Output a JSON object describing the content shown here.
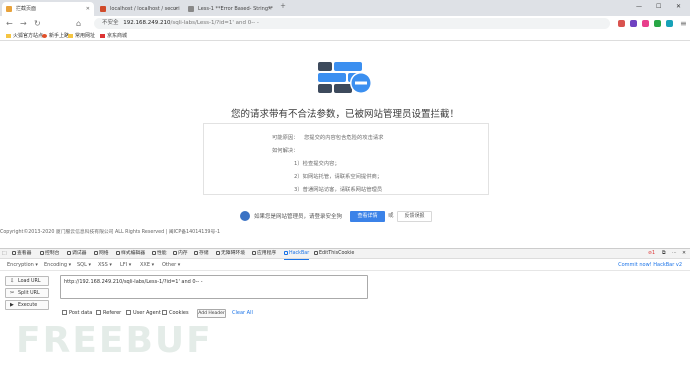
{
  "browser": {
    "tabs": [
      {
        "title": "拦截页面",
        "favicon_color": "#e8a23b"
      },
      {
        "title": "localhost / localhost / securi",
        "favicon_color": "#d04a2a"
      },
      {
        "title": "Less-1 **Error Based- String**",
        "favicon_color": "#888888"
      }
    ],
    "address": {
      "insecure_label": "不安全",
      "host": "192.168.249.210",
      "path": "/sqli-labs/Less-1/?id=1' and 0-- -"
    },
    "bookmarks": [
      "火狐官方站点",
      "新手上路",
      "常用网址",
      "京东商城"
    ]
  },
  "block_page": {
    "title": "您的请求带有不合法参数，已被网站管理员设置拦截！",
    "reason_label": "可能原因：",
    "reason_text": "您提交的内容包含危险的攻击请求",
    "howto_label": "如何解决：",
    "steps": [
      "1）检查提交内容；",
      "2）如网站托管，请联系空间提供商；",
      "3）普通网站访客，请联系网站管理员"
    ],
    "contact_text": "如果您是网站管理员，请登录安全狗",
    "detail_button": "查看详情",
    "or_text": "或",
    "feedback_button": "反馈误报",
    "copyright": "Copyright©2013-2020 厦门服云信息科技有限公司 ALL Rights Reserved | 闽ICP备14014139号-1",
    "accent_color": "#3b82e8"
  },
  "devtools": {
    "tabs": [
      "查看器",
      "控制台",
      "调试器",
      "网络",
      "样式编辑器",
      "性能",
      "内存",
      "存储",
      "无障碍环境",
      "应用程序",
      "HackBar",
      "EditThisCookie"
    ],
    "error_count": "1",
    "active_tab": "HackBar"
  },
  "hackbar": {
    "menu": [
      "Encryption ▾",
      "Encoding ▾",
      "SQL ▾",
      "XSS ▾",
      "LFI ▾",
      "XXE ▾",
      "Other ▾"
    ],
    "promo": "Commit now! HackBar v2",
    "load_url": "Load URL",
    "split_url": "Split URL",
    "execute": "Execute",
    "url_value": "http://192.168.249.210/sqli-labs/Less-1/?id=1' and 0-- -",
    "options": [
      "Post data",
      "Referer",
      "User Agent",
      "Cookies"
    ],
    "add_header": "Add Header",
    "clear_all": "Clear All"
  },
  "watermark": "FREEBUF"
}
